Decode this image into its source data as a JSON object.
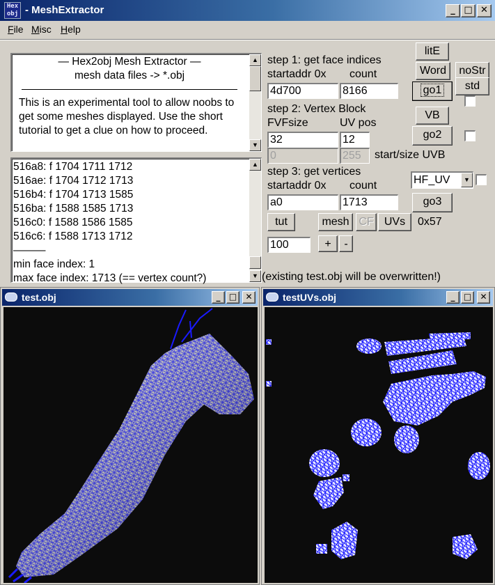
{
  "window": {
    "title": "MeshExtractor",
    "title_prefix": "- ",
    "icon_text": "Hex obj",
    "min_label": "_",
    "max_label": "□",
    "close_label": "✕"
  },
  "menu": [
    "File",
    "Misc",
    "Help"
  ],
  "info": {
    "heading": "—   Hex2obj Mesh Extractor   —",
    "subheading": "mesh data files -> *.obj",
    "body": "This is an experimental tool to allow noobs to get some meshes displayed. Use the short tutorial to get a clue on how to proceed."
  },
  "log": {
    "lines": [
      "516a8: f  1704 1711 1712",
      "516ae: f  1704 1712 1713",
      "516b4: f  1704 1713 1585",
      "516ba: f  1588 1585 1713",
      "516c0: f  1588 1586 1585",
      "516c6: f  1588 1713 1712"
    ],
    "separator": "———",
    "min_line": "min face index: 1",
    "max_line": "max face index: 1713 (== vertex count?)"
  },
  "step1": {
    "title": "step 1: get face indices",
    "startaddr_label": "startaddr 0x",
    "count_label": "count",
    "startaddr": "4d700",
    "count": "8166"
  },
  "step2": {
    "title": "step 2: Vertex Block",
    "fvf_label": "FVFsize",
    "uvpos_label": "UV pos",
    "fvfsize": "32",
    "uvpos": "12",
    "uvb_start": "0",
    "uvb_size": "255",
    "uvb_label": "start/size UVB"
  },
  "step3": {
    "title": "step 3: get vertices",
    "startaddr_label": "startaddr 0x",
    "count_label": "count",
    "startaddr": "a0",
    "count": "1713",
    "uv_select": "HF_UV"
  },
  "buttons": {
    "lite": "litE",
    "word": "Word",
    "nostr": "noStr",
    "std": "std",
    "go1": "go1",
    "vb": "VB",
    "go2": "go2",
    "go3": "go3",
    "tut": "tut",
    "mesh": "mesh",
    "cf": "CF",
    "uvs": "UVs",
    "plus": "+",
    "minus": "-"
  },
  "hex_value": "0x57",
  "zoom_value": "100",
  "warning": "(existing test.obj will be overwritten!)",
  "viewer1": {
    "title": "test.obj"
  },
  "viewer2": {
    "title": "testUVs.obj"
  },
  "colors": {
    "title_active": "#0a246a",
    "wire": "#1a1aff",
    "viewport_bg": "#0c0c0c",
    "face": "#c8c8c8"
  }
}
